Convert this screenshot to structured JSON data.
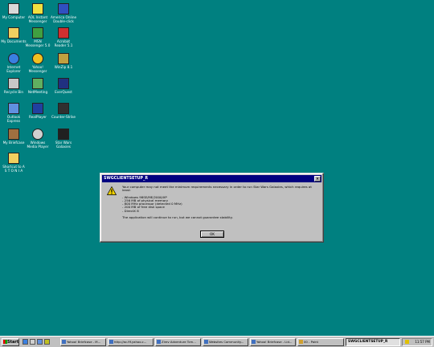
{
  "desktop": {
    "icons": [
      {
        "label": "My Computer",
        "icon": "computer-icon"
      },
      {
        "label": "AOL Instant\nMessenger",
        "icon": "aim-icon"
      },
      {
        "label": "America Online\nDouble-click",
        "icon": "aol-icon"
      },
      {
        "label": "My Documents",
        "icon": "folder-icon"
      },
      {
        "label": "MSN\nMessenger 5.0",
        "icon": "msn-icon"
      },
      {
        "label": "Acrobat\nReader 5.1",
        "icon": "acrobat-icon"
      },
      {
        "label": "Internet\nExplorer",
        "icon": "ie-icon"
      },
      {
        "label": "Yahoo!\nMessenger",
        "icon": "yahoo-icon"
      },
      {
        "label": "WinZip 8.1",
        "icon": "winzip-icon"
      },
      {
        "label": "Recycle Bin",
        "icon": "recycle-bin-icon"
      },
      {
        "label": "NetMeeting",
        "icon": "netmeeting-icon"
      },
      {
        "label": "EverQuest",
        "icon": "everquest-icon"
      },
      {
        "label": "Outlook\nExpress",
        "icon": "outlook-icon"
      },
      {
        "label": "RealPlayer",
        "icon": "realplayer-icon"
      },
      {
        "label": "Counter-Strike",
        "icon": "counter-strike-icon"
      },
      {
        "label": "My Briefcase",
        "icon": "briefcase-icon"
      },
      {
        "label": "Windows\nMedia Player",
        "icon": "media-player-icon"
      },
      {
        "label": "Star Wars\nGalaxies",
        "icon": "star-wars-icon"
      },
      {
        "label": "Shortcut to A\nS T O N I A",
        "icon": "folder-shortcut-icon"
      }
    ]
  },
  "dialog": {
    "title": "SWGCLIENTSETUP_R",
    "close_label": "×",
    "intro": "Your computer may not meet the minimum requirements necessary in order to run Star Wars Galaxies, which requires at least:",
    "requirements": [
      "- Windows 98SE/ME/2000/XP",
      "- 256 MB of physical memory",
      "- 800 MHz processor (detected 0 MHz)",
      "- 200 MB of free disk space",
      "- DirectX 8"
    ],
    "footer": "The application will continue to run, but we cannot guarantee stability.",
    "ok_label": "OK"
  },
  "taskbar": {
    "start_label": "Start",
    "tasks": [
      "Yahoo! Briefcase - M...",
      "http://ac.fif.yahoo.c...",
      "Zirev Adventure Tcm...",
      "Websites Community...",
      "Yahoo! Briefcase - Lid...",
      "00 - Paint"
    ],
    "active_task": "SWGCLIENTSETUP_R",
    "clock": "11:57 PM"
  },
  "colors": {
    "desktop": "#008080",
    "titlebar": "#000080",
    "window": "#c0c0c0"
  }
}
